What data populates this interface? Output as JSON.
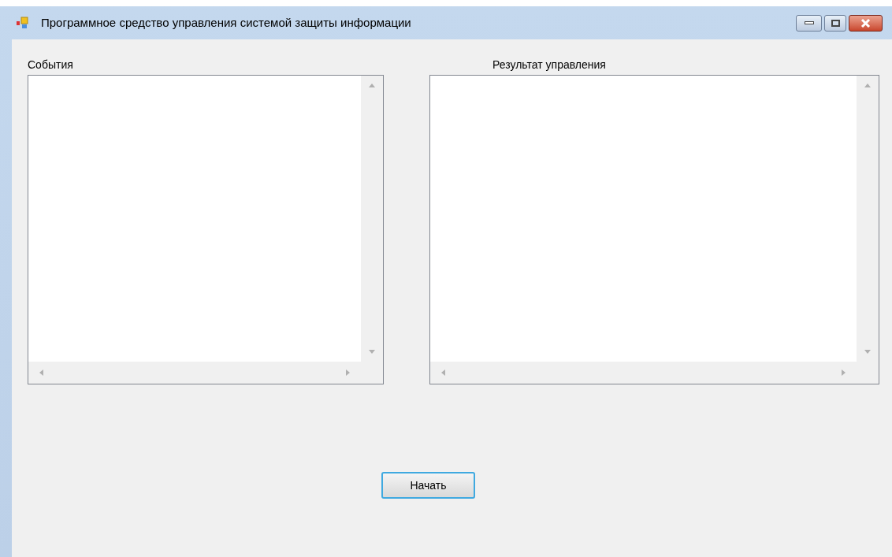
{
  "window": {
    "title": "Программное средство управления системой защиты информации"
  },
  "panels": [
    {
      "label": "События"
    },
    {
      "label": "Результат управления"
    }
  ],
  "button": {
    "label": "Начать"
  }
}
